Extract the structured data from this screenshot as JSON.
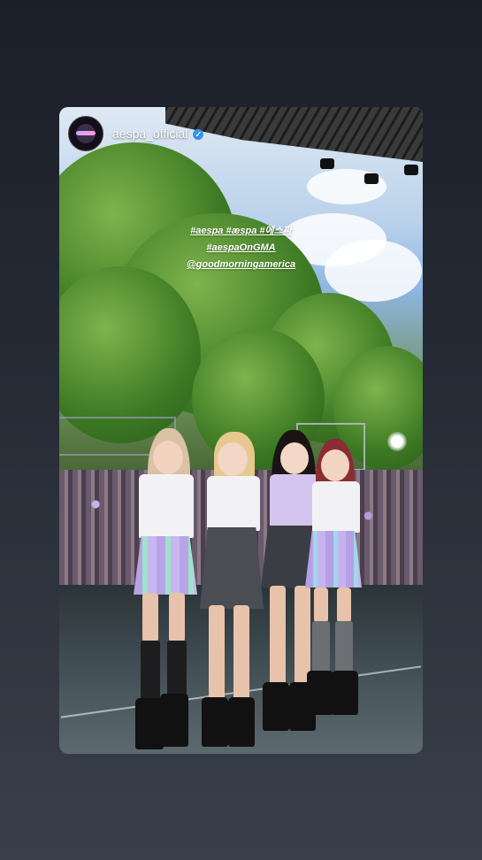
{
  "story": {
    "account": {
      "username": "aespa_official",
      "verified": true,
      "verified_badge_color": "#3797f0"
    },
    "caption_lines": [
      "#aespa #æspa #에스파",
      "#aespaOnGMA",
      "@goodmorningamerica"
    ]
  },
  "icons": {
    "verified": "verified-badge-icon"
  },
  "colors": {
    "background_top": "#1b1f29",
    "background_bottom": "#3a404b"
  }
}
